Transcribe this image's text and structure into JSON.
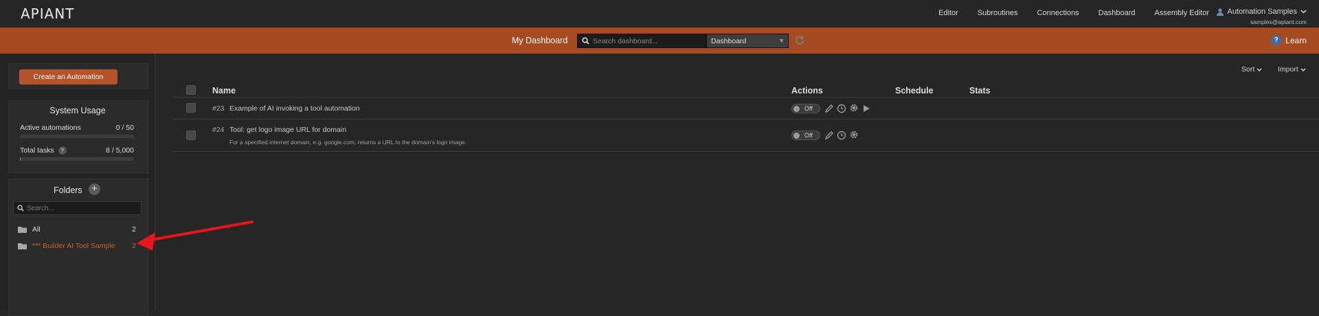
{
  "app": {
    "logo": "APIANT"
  },
  "nav": {
    "links": [
      "Editor",
      "Subroutines",
      "Connections",
      "Dashboard",
      "Assembly Editor"
    ],
    "user_name": "Automation Samples",
    "user_email": "samples@apiant.com"
  },
  "toolbar": {
    "title": "My Dashboard",
    "search_placeholder": "Search dashboard...",
    "view_selected": "Dashboard",
    "learn_label": "Learn",
    "accent_color": "#a64a22"
  },
  "sidebar": {
    "create_button": "Create an Automation",
    "system_usage": {
      "title": "System Usage",
      "active_label": "Active automations",
      "active_value": "0 / 50",
      "active_fraction": 0,
      "tasks_label": "Total tasks",
      "tasks_value": "8 / 5,000",
      "tasks_fraction": 0.0016
    },
    "folders": {
      "title": "Folders",
      "search_placeholder": "Search...",
      "items": [
        {
          "label": "All",
          "count": "2"
        },
        {
          "label": "*** Builder AI Tool Sample",
          "count": "2"
        }
      ]
    }
  },
  "main": {
    "sort_label": "Sort",
    "import_label": "Import",
    "columns": {
      "name": "Name",
      "actions": "Actions",
      "schedule": "Schedule",
      "stats": "Stats"
    },
    "rows": [
      {
        "id": "#23",
        "name": "Example of AI invoking a tool automation",
        "description": "",
        "status": "Off"
      },
      {
        "id": "#24",
        "name": "Tool: get logo image URL for domain",
        "description": "For a specified internet domain, e.g. google.com, returns a URL to the domain's logo image.",
        "status": "Off"
      }
    ]
  }
}
